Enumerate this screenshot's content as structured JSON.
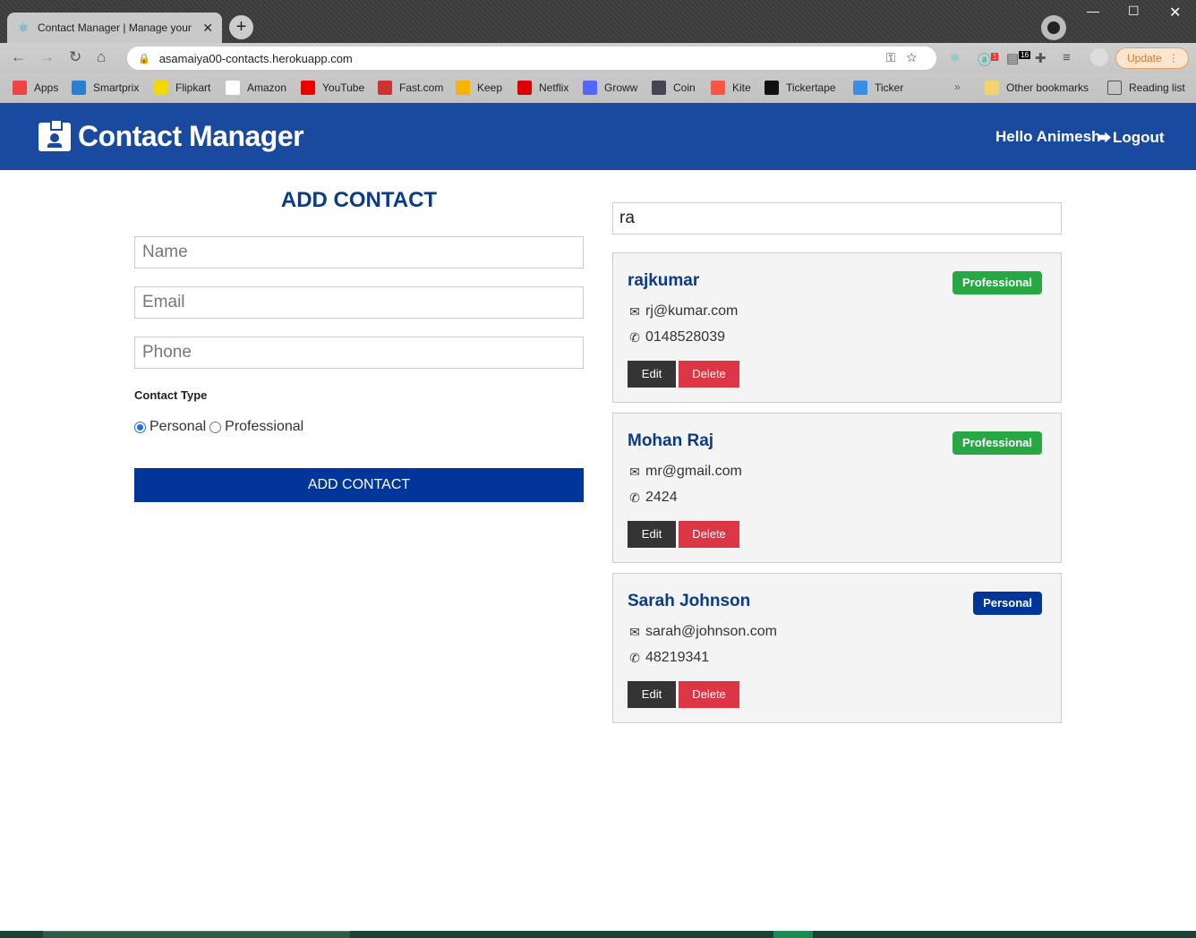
{
  "browser": {
    "tab_title": "Contact Manager | Manage your",
    "tab_close": "✕",
    "new_tab": "+",
    "url": "asamaiya00-contacts.herokuapp.com",
    "update_label": "Update",
    "extension_badges": {
      "grammarly": "1",
      "clipboard": "16"
    },
    "bookmarks": [
      {
        "label": "Apps",
        "icon": "apps-grid-icon",
        "color": "#e44"
      },
      {
        "label": "Smartprix",
        "icon": "smartprix-icon",
        "color": "#2a7fd4"
      },
      {
        "label": "Flipkart",
        "icon": "flipkart-icon",
        "color": "#f5d800"
      },
      {
        "label": "Amazon",
        "icon": "amazon-icon",
        "color": "#fff"
      },
      {
        "label": "YouTube",
        "icon": "youtube-icon",
        "color": "#e00"
      },
      {
        "label": "Fast.com",
        "icon": "fastcom-icon",
        "color": "#c33"
      },
      {
        "label": "Keep",
        "icon": "keep-icon",
        "color": "#f6b400"
      },
      {
        "label": "Netflix",
        "icon": "netflix-icon",
        "color": "#d00"
      },
      {
        "label": "Groww",
        "icon": "groww-icon",
        "color": "#5367ff"
      },
      {
        "label": "Coin",
        "icon": "coin-icon",
        "color": "#445"
      },
      {
        "label": "Kite",
        "icon": "kite-icon",
        "color": "#f54"
      },
      {
        "label": "Tickertape",
        "icon": "tickertape-icon",
        "color": "#111"
      },
      {
        "label": "Ticker",
        "icon": "ticker-icon",
        "color": "#3a8ee6"
      }
    ],
    "more_bookmarks": "»",
    "other_bookmarks": "Other bookmarks",
    "reading_list": "Reading list"
  },
  "navbar": {
    "brand": "Contact Manager",
    "greeting": "Hello Animesh",
    "logout": "Logout",
    "bg_color": "#1a4aa0"
  },
  "form": {
    "title": "ADD CONTACT",
    "name_placeholder": "Name",
    "email_placeholder": "Email",
    "phone_placeholder": "Phone",
    "contact_type_label": "Contact Type",
    "type_options": [
      "Personal",
      "Professional"
    ],
    "selected_type": "Personal",
    "submit_label": "ADD CONTACT"
  },
  "search": {
    "value": "ra"
  },
  "contacts": [
    {
      "name": "rajkumar",
      "type": "Professional",
      "type_color": "#28a745",
      "email": "rj@kumar.com",
      "phone": "0148528039"
    },
    {
      "name": "Mohan Raj",
      "type": "Professional",
      "type_color": "#28a745",
      "email": "mr@gmail.com",
      "phone": "2424"
    },
    {
      "name": "Sarah Johnson",
      "type": "Personal",
      "type_color": "#003699",
      "email": "sarah@johnson.com",
      "phone": "48219341"
    }
  ],
  "card_actions": {
    "edit": "Edit",
    "delete": "Delete"
  }
}
